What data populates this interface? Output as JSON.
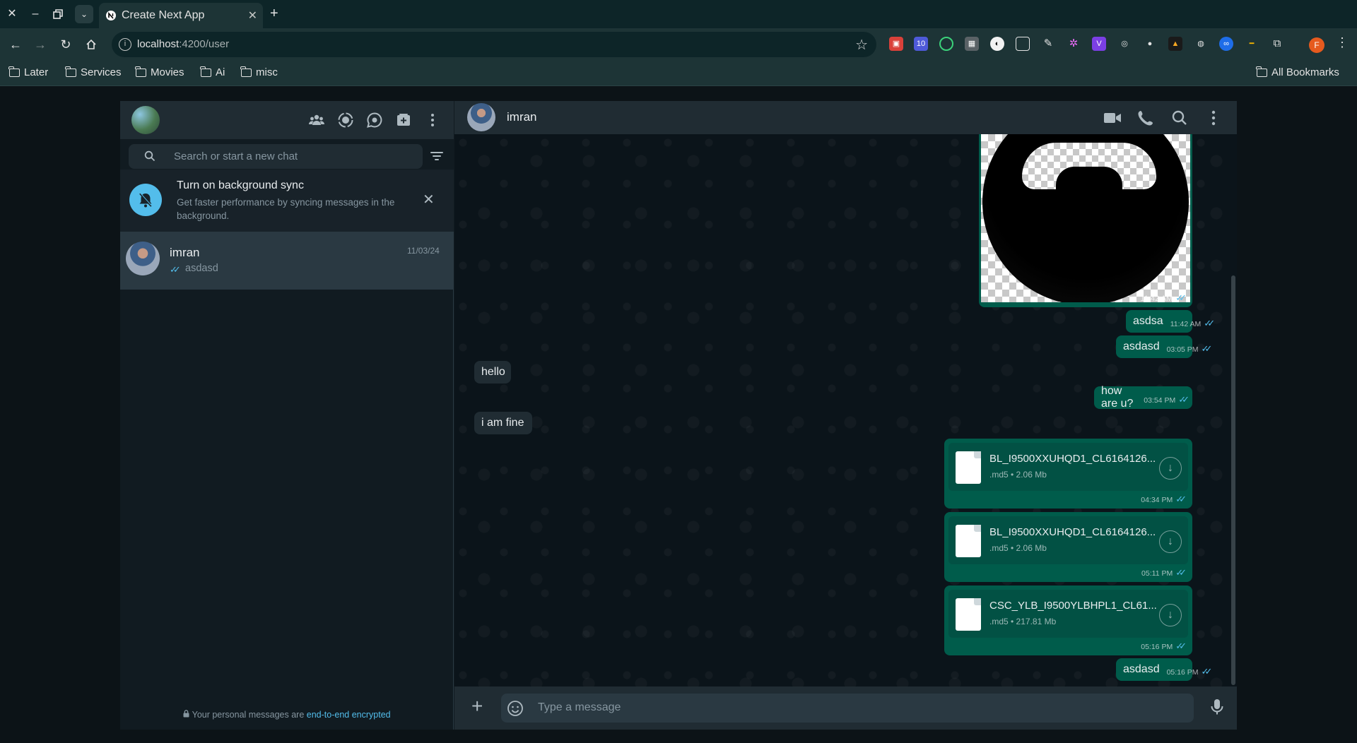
{
  "browser": {
    "tab_title": "Create Next App",
    "url_host": "localhost",
    "url_rest": ":4200/user",
    "bookmarks": [
      "Later",
      "Services",
      "Movies",
      "Ai",
      "misc"
    ],
    "all_bookmarks": "All Bookmarks",
    "ext_badge": "10",
    "profile_initial": "F"
  },
  "sidebar": {
    "search_placeholder": "Search or start a new chat",
    "banner": {
      "title": "Turn on background sync",
      "description": "Get faster performance by syncing messages in the background."
    },
    "chats": [
      {
        "name": "imran",
        "date": "11/03/24",
        "preview": "asdasd"
      }
    ],
    "footer_text": "Your personal messages are ",
    "footer_link": "end-to-end encrypted"
  },
  "conversation": {
    "contact_name": "imran",
    "messages": [
      {
        "type": "image",
        "direction": "out",
        "time": "11:42 AM"
      },
      {
        "type": "text",
        "direction": "out",
        "text": "asdsa",
        "time": "11:42 AM"
      },
      {
        "type": "text",
        "direction": "out",
        "text": "asdasd",
        "time": "03:05 PM"
      },
      {
        "type": "text",
        "direction": "in",
        "text": "hello"
      },
      {
        "type": "text",
        "direction": "out",
        "text": "how are u?",
        "time": "03:54 PM"
      },
      {
        "type": "text",
        "direction": "in",
        "text": "i am fine"
      },
      {
        "type": "file",
        "direction": "out",
        "name": "BL_I9500XXUHQD1_CL6164126...",
        "info": ".md5 • 2.06 Mb",
        "time": "04:34 PM"
      },
      {
        "type": "file",
        "direction": "out",
        "name": "BL_I9500XXUHQD1_CL6164126...",
        "info": ".md5 • 2.06 Mb",
        "time": "05:11 PM"
      },
      {
        "type": "file",
        "direction": "out",
        "name": "CSC_YLB_I9500YLBHPL1_CL61...",
        "info": ".md5 • 217.81 Mb",
        "time": "05:16 PM"
      },
      {
        "type": "text",
        "direction": "out",
        "text": "asdasd",
        "time": "05:16 PM"
      }
    ],
    "composer_placeholder": "Type a message"
  },
  "colors": {
    "outgoing_bubble": "#005c4b",
    "incoming_bubble": "#202c33",
    "read_ticks": "#53bdeb",
    "panel": "#202c33",
    "chat_bg": "#0b141a"
  },
  "icons": [
    "communities-icon",
    "status-icon",
    "channels-icon",
    "new-chat-icon",
    "menu-icon",
    "search-icon",
    "filter-icon",
    "bell-off-icon",
    "close-icon",
    "video-call-icon",
    "phone-icon",
    "download-icon",
    "plus-icon",
    "emoji-icon",
    "mic-icon",
    "lock-icon"
  ]
}
